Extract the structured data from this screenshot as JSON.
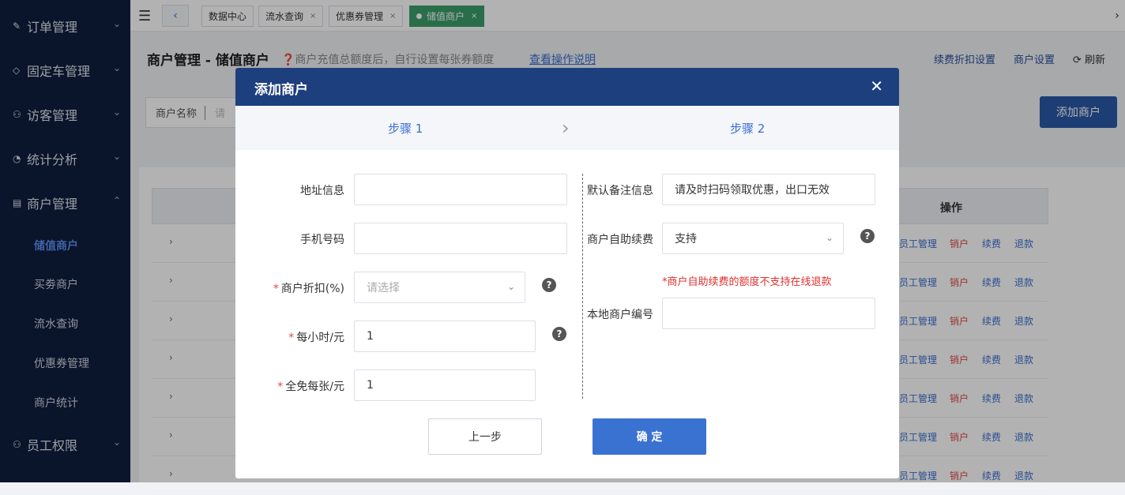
{
  "sidebar": {
    "items": [
      {
        "icon": "edit-icon",
        "glyph": "✎",
        "label": "订单管理",
        "chev": "⌄"
      },
      {
        "icon": "diamond-icon",
        "glyph": "◇",
        "label": "固定车管理",
        "chev": "⌄"
      },
      {
        "icon": "visitor-icon",
        "glyph": "⚇",
        "label": "访客管理",
        "chev": "⌄"
      },
      {
        "icon": "clock-icon",
        "glyph": "◔",
        "label": "统计分析",
        "chev": "⌄"
      },
      {
        "icon": "shop-icon",
        "glyph": "▤",
        "label": "商户管理",
        "chev": "⌃"
      },
      {
        "icon": "staff-icon",
        "glyph": "⚇",
        "label": "员工权限",
        "chev": "⌄"
      }
    ],
    "subitems": [
      "储值商户",
      "买劵商户",
      "流水查询",
      "优惠券管理",
      "商户统计"
    ]
  },
  "tabs": {
    "prev": "‹",
    "next": "›",
    "items": [
      {
        "label": "数据中心"
      },
      {
        "label": "流水查询",
        "close": "×"
      },
      {
        "label": "优惠券管理",
        "close": "×"
      },
      {
        "label": "储值商户",
        "close": "×"
      }
    ]
  },
  "header": {
    "title": "商户管理 - 储值商户",
    "hint": "❓商户充值总额度后，自行设置每张券额度",
    "help_link": "查看操作说明",
    "links": [
      "续费折扣设置",
      "商户设置"
    ],
    "refresh": "⟳ 刷新"
  },
  "filter": {
    "label": "商户名称",
    "placeholder": "请"
  },
  "add_button": "添加商户",
  "table": {
    "op_header": "操作",
    "actions": {
      "staff": "员工管理",
      "cancel": "销户",
      "renew": "续费",
      "refund": "退款"
    },
    "expand_glyph": "›"
  },
  "modal": {
    "title": "添加商户",
    "close": "✕",
    "steps": [
      "步骤 1",
      "步骤 2"
    ],
    "step_arrow": "›",
    "left": {
      "address_label": "地址信息",
      "address_value": "",
      "phone_label": "手机号码",
      "phone_value": "",
      "discount_label": "商户折扣(%)",
      "discount_placeholder": "请选择",
      "hourly_label": "每小时/元",
      "hourly_value": "1",
      "free_label": "全免每张/元",
      "free_value": "1"
    },
    "right": {
      "remark_label": "默认备注信息",
      "remark_value": "请及时扫码领取优惠，出口无效",
      "self_renew_label": "商户自助续费",
      "self_renew_value": "支持",
      "warning": "*商户自助续费的额度不支持在线退款",
      "local_id_label": "本地商户编号",
      "local_id_value": ""
    },
    "required_mark": "*",
    "help_glyph": "?",
    "prev_button": "上一步",
    "ok_button": "确 定"
  }
}
